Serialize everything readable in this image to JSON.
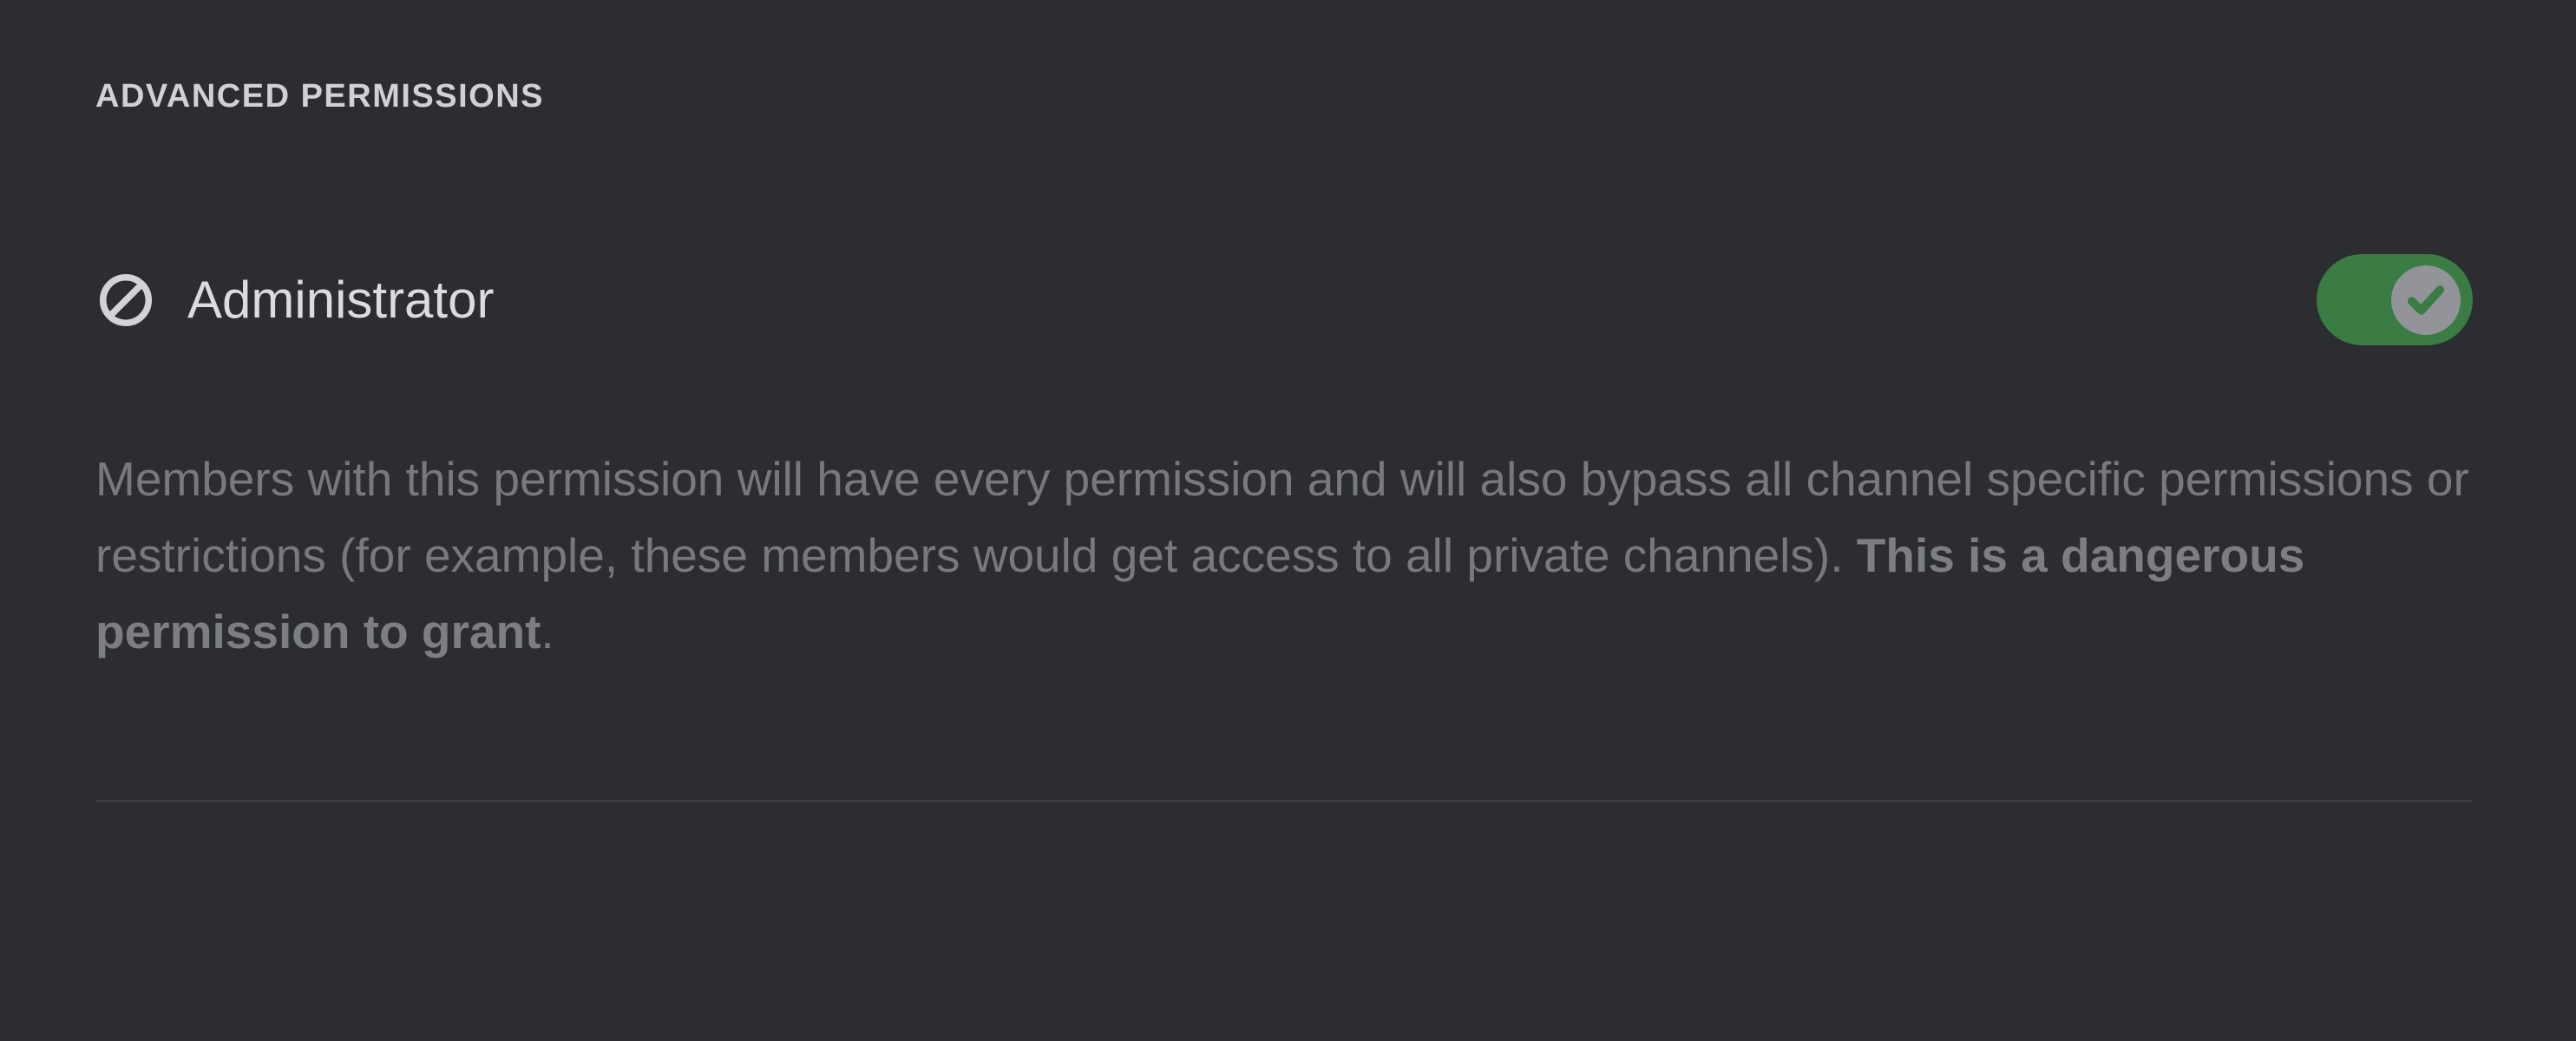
{
  "section": {
    "header": "Advanced Permissions"
  },
  "permission": {
    "title": "Administrator",
    "description_normal": "Members with this permission will have every permission and will also bypass all channel specific permissions or restrictions (for example, these members would get access to all private channels). ",
    "description_bold": "This is a dangerous permission to grant",
    "description_end": ".",
    "toggle_enabled": true
  },
  "icons": {
    "prohibit": "prohibit-icon",
    "check": "check-icon"
  },
  "colors": {
    "background": "#2b2d31",
    "toggle_on": "#3b7c44",
    "text_header": "#cfd1d4",
    "text_title": "#dbdcde",
    "text_description": "#77797f"
  }
}
